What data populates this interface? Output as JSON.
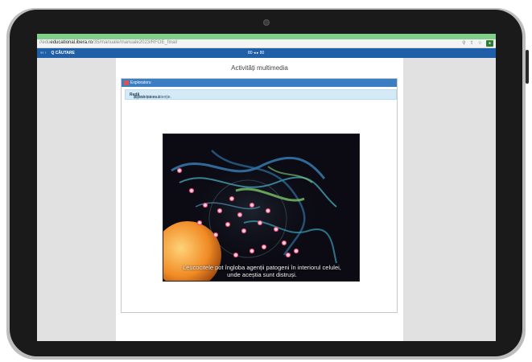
{
  "browser": {
    "url_prefix": "//edu",
    "url_domain": "educational.ibera.ro",
    "url_path": "/35/manuale/manuale2023/RFOE_final/",
    "icons": [
      "zoom-icon",
      "share-icon",
      "star-icon",
      "profile-icon"
    ]
  },
  "appbar": {
    "back_label": "«‹ ›",
    "search_label": "Q CĂUTARE",
    "page_indicator": "80 ◂ ▸ 80"
  },
  "page": {
    "title": "Activități multimedia"
  },
  "panel": {
    "header_label": "Exploratoru",
    "instruction_prefix": "Apasă butonul ",
    "instruction_bold": "Redă",
    "instruction_suffix": " și privește cu atenție."
  },
  "video": {
    "subtitle_line1": "Leucocitele pot îngloba agenții patogeni în interiorul celulei,",
    "subtitle_line2": "unde aceștia sunt distruși."
  },
  "colors": {
    "tab_strip": "#7fcf8a",
    "app_bar": "#1f5fa8",
    "panel_header": "#3b7ec3",
    "instruction_bg": "#d4eaf6",
    "tablet_frame": "#1a1a1a"
  }
}
